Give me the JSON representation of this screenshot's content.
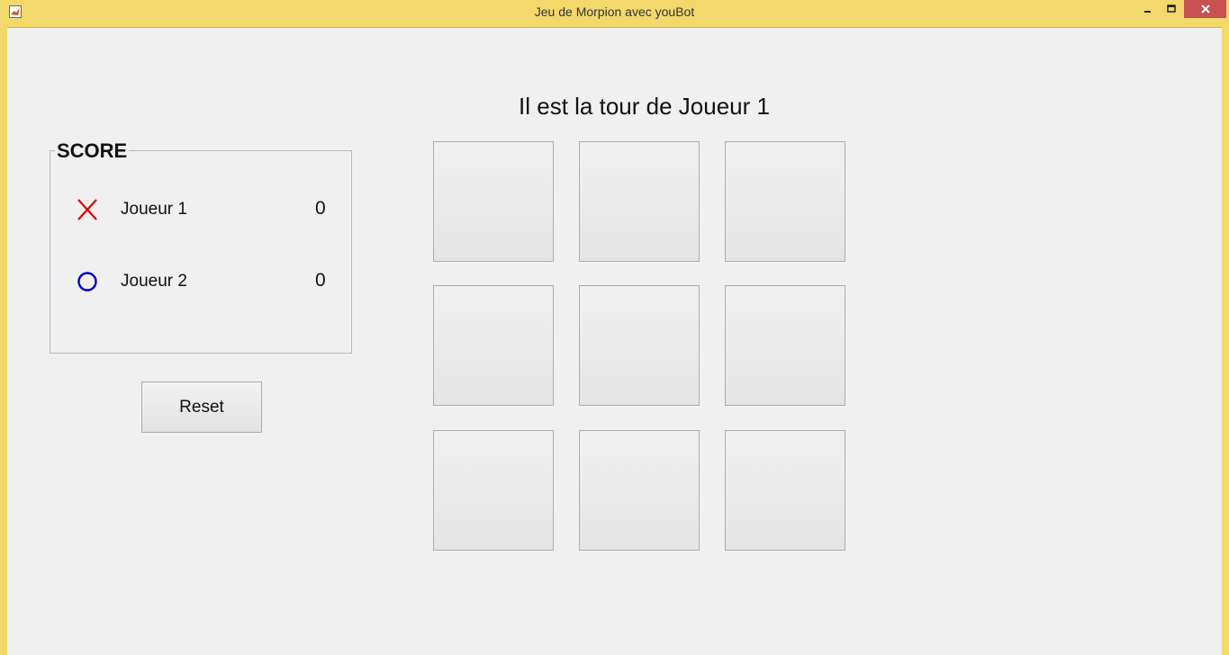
{
  "window": {
    "title": "Jeu de Morpion avec youBot"
  },
  "game": {
    "turn_label": "Il est la tour de Joueur 1",
    "board": [
      "",
      "",
      "",
      "",
      "",
      "",
      "",
      "",
      ""
    ]
  },
  "score": {
    "title": "SCORE",
    "players": [
      {
        "name": "Joueur 1",
        "symbol_icon": "x-icon",
        "color": "#e00000",
        "score": "0"
      },
      {
        "name": "Joueur 2",
        "symbol_icon": "o-icon",
        "color": "#0000cc",
        "score": "0"
      }
    ]
  },
  "controls": {
    "reset_label": "Reset"
  }
}
